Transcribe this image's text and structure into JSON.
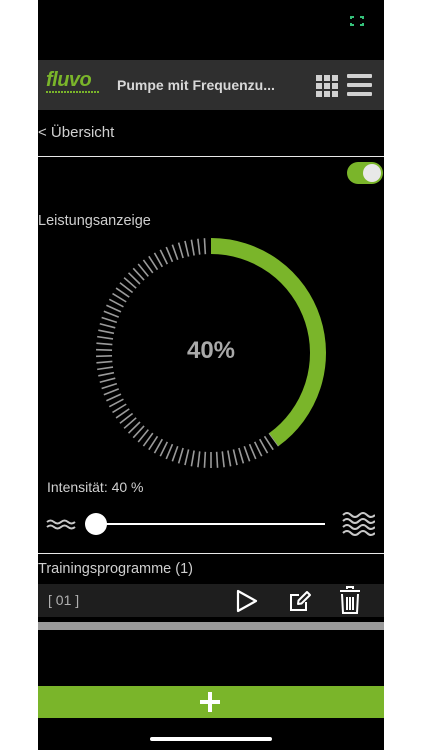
{
  "header": {
    "logo_text": "fluvo",
    "title": "Pumpe mit Frequenzu..."
  },
  "nav": {
    "back_label": "< Übersicht"
  },
  "power": {
    "enabled": true,
    "section_label": "Leistungsanzeige",
    "display_value": "40%",
    "level_percent": 40
  },
  "intensity": {
    "label": "Intensität: 40 %",
    "value_percent": 40
  },
  "programs": {
    "section_label": "Trainingsprogramme   (1)",
    "items": [
      {
        "id": "[ 01 ]"
      }
    ]
  },
  "icons": {
    "grid": "grid-icon",
    "menu": "menu-icon",
    "wave_low": "wave-low-icon",
    "wave_high": "wave-high-icon",
    "play": "play-icon",
    "edit": "edit-icon",
    "delete": "trash-icon",
    "add": "plus-icon"
  },
  "colors": {
    "accent": "#7ab52a",
    "header_bg": "#2f2f2f",
    "background": "#000000",
    "gauge_inactive": "#9a9a9a"
  }
}
